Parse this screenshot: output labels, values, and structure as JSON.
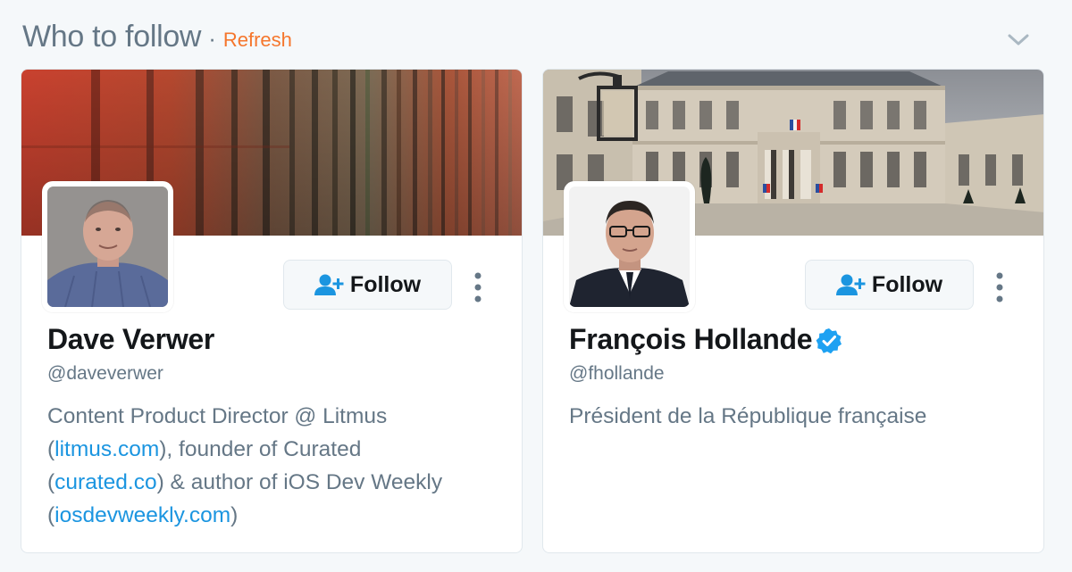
{
  "header": {
    "title": "Who to follow",
    "separator": "·",
    "refresh_label": "Refresh"
  },
  "colors": {
    "accent_orange": "#f5762c",
    "link_blue": "#1b95e0",
    "verified_blue": "#1da1f2",
    "muted_text": "#657786"
  },
  "cards": [
    {
      "name": "Dave Verwer",
      "handle": "@daveverwer",
      "follow_label": "Follow",
      "verified": false,
      "bio": {
        "t1": "Content Product Director @ Litmus",
        "t2": "(",
        "l1": "litmus.com",
        "t3": "), founder of Curated",
        "t4": "(",
        "l2": "curated.co",
        "t5": ") & author of iOS Dev Weekly",
        "t6": "(",
        "l3": "iosdevweekly.com",
        "t7": ")"
      }
    },
    {
      "name": "François Hollande",
      "handle": "@fhollande",
      "follow_label": "Follow",
      "verified": true,
      "bio": {
        "t1": "Président de la République française"
      }
    }
  ]
}
